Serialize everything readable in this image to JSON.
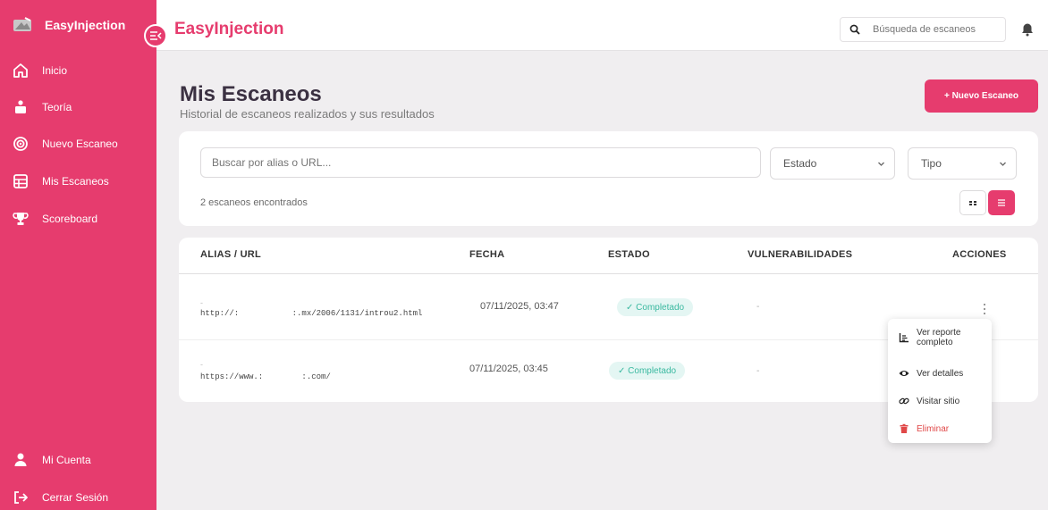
{
  "sidebar": {
    "brand": "EasyInjection",
    "items": [
      {
        "label": "Inicio",
        "icon": "home-icon"
      },
      {
        "label": "Teoría",
        "icon": "teacher-icon"
      },
      {
        "label": "Nuevo Escaneo",
        "icon": "target-icon"
      },
      {
        "label": "Mis Escaneos",
        "icon": "table-icon"
      },
      {
        "label": "Scoreboard",
        "icon": "trophy-icon"
      }
    ],
    "bottom": [
      {
        "label": "Mi Cuenta",
        "icon": "user-icon"
      },
      {
        "label": "Cerrar Sesión",
        "icon": "logout-icon"
      }
    ]
  },
  "header": {
    "title": "EasyInjection",
    "search_placeholder": "Búsqueda de escaneos"
  },
  "page": {
    "title": "Mis Escaneos",
    "subtitle": "Historial de escaneos realizados y sus resultados",
    "new_button": "+ Nuevo Escaneo"
  },
  "filters": {
    "search_placeholder": "Buscar por alias o URL...",
    "estado": "Estado",
    "tipo": "Tipo",
    "count_text": "2 escaneos encontrados"
  },
  "table": {
    "headers": [
      "ALIAS / URL",
      "FECHA",
      "ESTADO",
      "VULNERABILIDADES",
      "ACCIONES"
    ],
    "rows": [
      {
        "alias": "-",
        "url": "http://:           :.mx/2006/1131/introu2.html",
        "date": "07/11/2025, 03:47",
        "status": "✓ Completado",
        "vulns": "-"
      },
      {
        "alias": "-",
        "url": "https://www.:        :.com/",
        "date": "07/11/2025, 03:45",
        "status": "✓ Completado",
        "vulns": "-"
      }
    ]
  },
  "menu": {
    "items": [
      {
        "label": "Ver reporte completo",
        "icon": "chart-icon"
      },
      {
        "label": "Ver detalles",
        "icon": "eye-icon"
      },
      {
        "label": "Visitar sitio",
        "icon": "link-icon"
      },
      {
        "label": "Eliminar",
        "icon": "trash-icon"
      }
    ]
  },
  "colors": {
    "accent": "#e63c6e",
    "success": "#3ab9a0",
    "danger": "#e04848"
  }
}
